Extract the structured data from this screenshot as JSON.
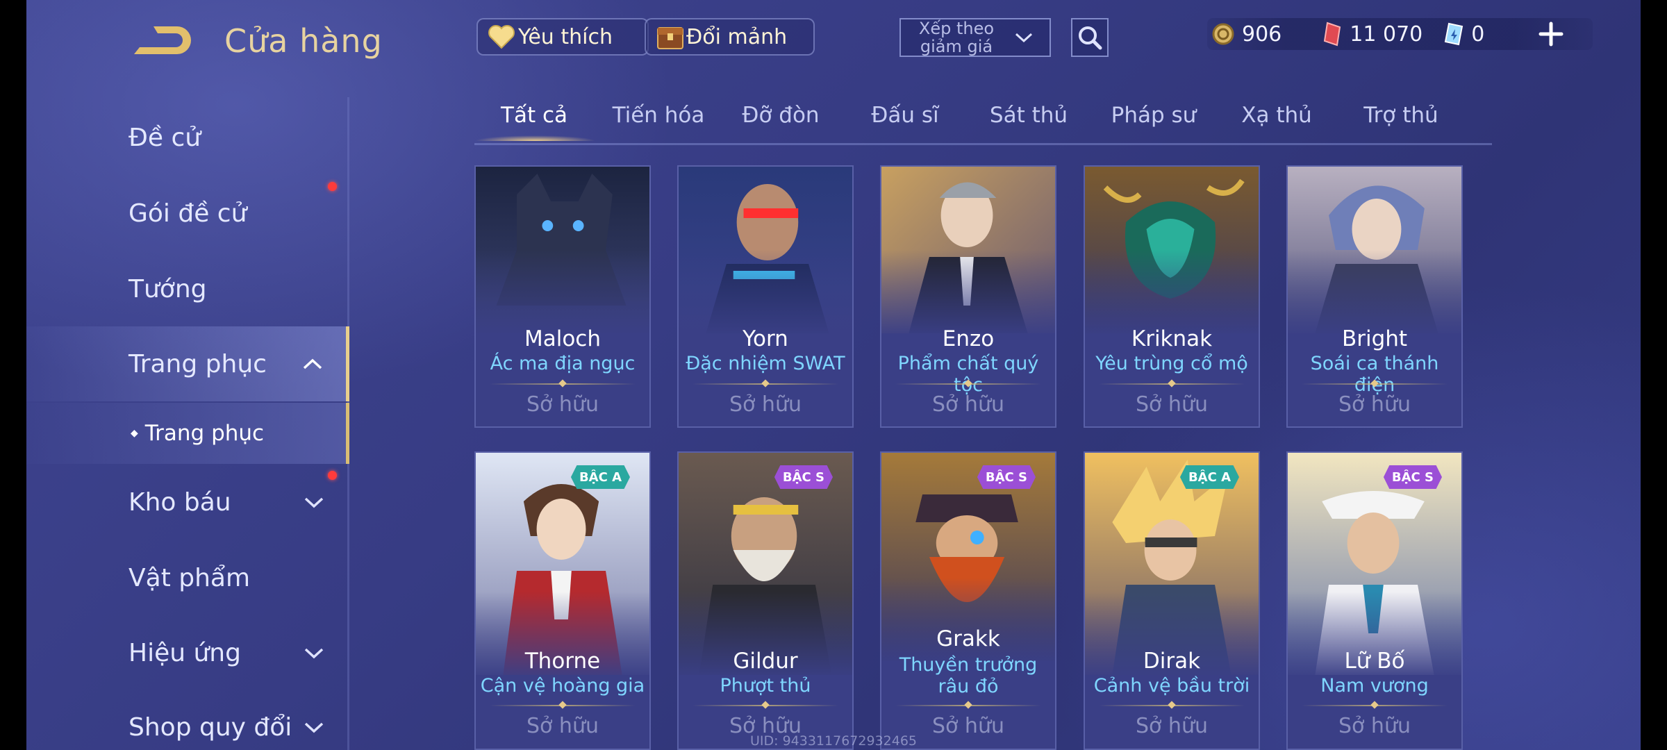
{
  "header": {
    "title": "Cửa hàng",
    "favorite_label": "Yêu thích",
    "shard_label": "Đổi mảnh",
    "sort_label": "Xếp theo giảm giá",
    "currencies": [
      {
        "icon": "gold-coin-icon",
        "value": "906"
      },
      {
        "icon": "red-voucher-icon",
        "value": "11 070"
      },
      {
        "icon": "blue-ticket-icon",
        "value": "0"
      }
    ]
  },
  "sidebar": {
    "items": [
      {
        "label": "Đề cử",
        "badge": false
      },
      {
        "label": "Gói đề cử",
        "badge": true
      },
      {
        "label": "Tướng",
        "badge": false
      },
      {
        "label": "Trang phục",
        "badge": false,
        "active": true
      },
      {
        "label": "Trang phục",
        "sub": true
      },
      {
        "label": "Kho báu",
        "badge": true
      },
      {
        "label": "Vật phẩm",
        "badge": false
      },
      {
        "label": "Hiệu ứng",
        "badge": false
      },
      {
        "label": "Shop quy đổi",
        "badge": false
      }
    ]
  },
  "tabs": [
    "Tất cả",
    "Tiến hóa",
    "Đỡ đòn",
    "Đấu sĩ",
    "Sát thủ",
    "Pháp sư",
    "Xạ thủ",
    "Trợ thủ"
  ],
  "cards": [
    {
      "hero": "Maloch",
      "skin": "Ác ma địa ngục",
      "status": "Sở hữu",
      "rank": ""
    },
    {
      "hero": "Yorn",
      "skin": "Đặc nhiệm SWAT",
      "status": "Sở hữu",
      "rank": ""
    },
    {
      "hero": "Enzo",
      "skin": "Phẩm chất quý tộc",
      "status": "Sở hữu",
      "rank": ""
    },
    {
      "hero": "Kriknak",
      "skin": "Yêu trùng cổ mộ",
      "status": "Sở hữu",
      "rank": ""
    },
    {
      "hero": "Bright",
      "skin": "Soái ca thánh điện",
      "status": "Sở hữu",
      "rank": ""
    },
    {
      "hero": "Thorne",
      "skin": "Cận vệ hoàng gia",
      "status": "Sở hữu",
      "rank": "BẬC A"
    },
    {
      "hero": "Gildur",
      "skin": "Phượt thủ",
      "status": "Sở hữu",
      "rank": "BẬC S"
    },
    {
      "hero": "Grakk",
      "skin": "Thuyền trưởng râu đỏ",
      "status": "Sở hữu",
      "rank": "BẬC S"
    },
    {
      "hero": "Dirak",
      "skin": "Cảnh vệ bầu trời",
      "status": "Sở hữu",
      "rank": "BẬC A"
    },
    {
      "hero": "Lữ Bố",
      "skin": "Nam vương",
      "status": "Sở hữu",
      "rank": "BẬC S"
    }
  ],
  "footer": {
    "uid": "UID: 9433117672932465"
  },
  "colors": {
    "accent_gold": "#e8cf8c",
    "skin_name_blue": "#7fd6ff",
    "rank_a": "#2aa8a0",
    "rank_s": "#9b4fd6",
    "badge_red": "#ff3b3b"
  }
}
